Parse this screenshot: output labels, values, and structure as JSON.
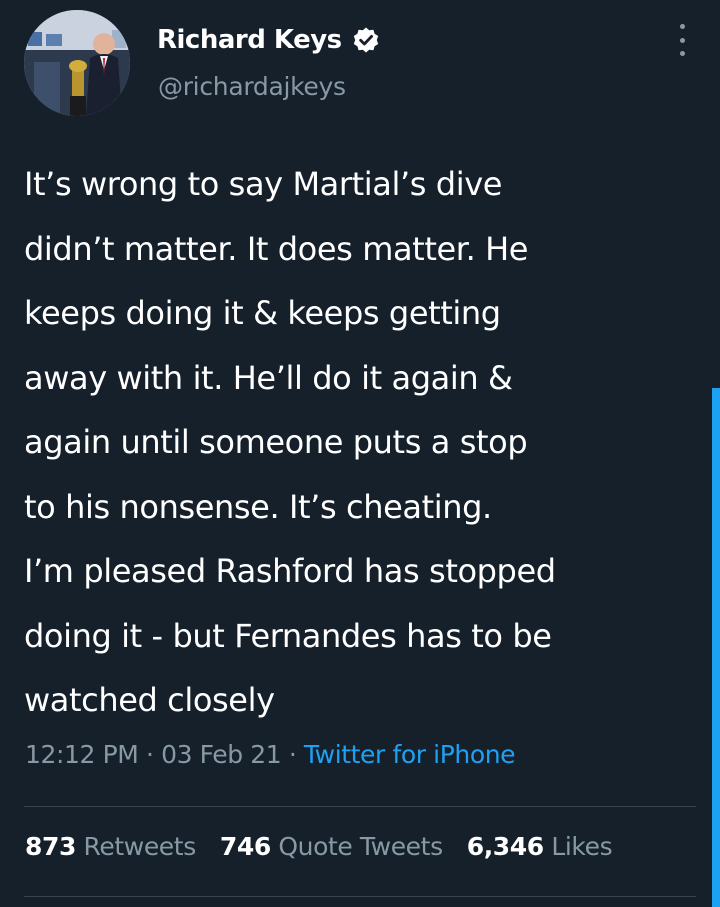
{
  "author": {
    "name": "Richard Keys",
    "handle": "@richardajkeys",
    "verified": true,
    "avatar": "avatar-photo",
    "verified_icon": "verified-badge-icon"
  },
  "more_icon": "more-vertical-icon",
  "tweet": {
    "lines": [
      "It’s wrong to say Martial’s dive",
      "didn’t matter. It does matter. He",
      "keeps doing it & keeps getting",
      "away with it. He’ll do it again &",
      "again until someone puts a stop",
      "to his nonsense. It’s cheating.",
      "I’m pleased Rashford has stopped",
      "doing it - but Fernandes has to be",
      "watched closely"
    ]
  },
  "meta": {
    "time": "12:12 PM",
    "date": "03 Feb 21",
    "separator": "·",
    "source": "Twitter for iPhone"
  },
  "stats": {
    "retweets": {
      "count": "873",
      "label": "Retweets"
    },
    "quote_tweets": {
      "count": "746",
      "label": "Quote Tweets"
    },
    "likes": {
      "count": "6,346",
      "label": "Likes"
    }
  },
  "colors": {
    "background": "#15202b",
    "text": "#ffffff",
    "secondary": "#8899a6",
    "link": "#1da1f2",
    "divider": "#38444d"
  }
}
